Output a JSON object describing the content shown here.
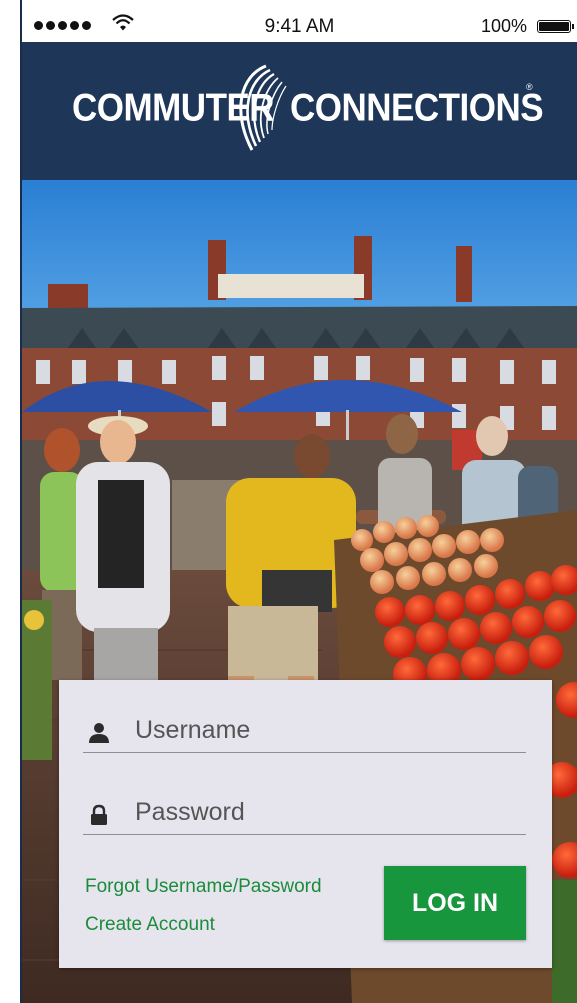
{
  "status_bar": {
    "time": "9:41 AM",
    "battery": "100%",
    "signal_icon": "signal-dots-icon",
    "wifi_icon": "wifi-icon",
    "battery_icon": "battery-icon"
  },
  "header": {
    "logo_left": "COMMUTER",
    "logo_right": "CONNECTIONS",
    "logo_reg": "®",
    "background_color": "#1e3658"
  },
  "login": {
    "username_placeholder": "Username",
    "password_placeholder": "Password",
    "username_icon": "user-icon",
    "password_icon": "lock-icon",
    "forgot_label": "Forgot Username/Password",
    "create_label": "Create Account",
    "login_label": "LOG IN",
    "accent_color": "#18963e",
    "link_color": "#1a8c3b",
    "card_color": "#e6e5ee"
  },
  "background_image": "farmers-market-photo"
}
